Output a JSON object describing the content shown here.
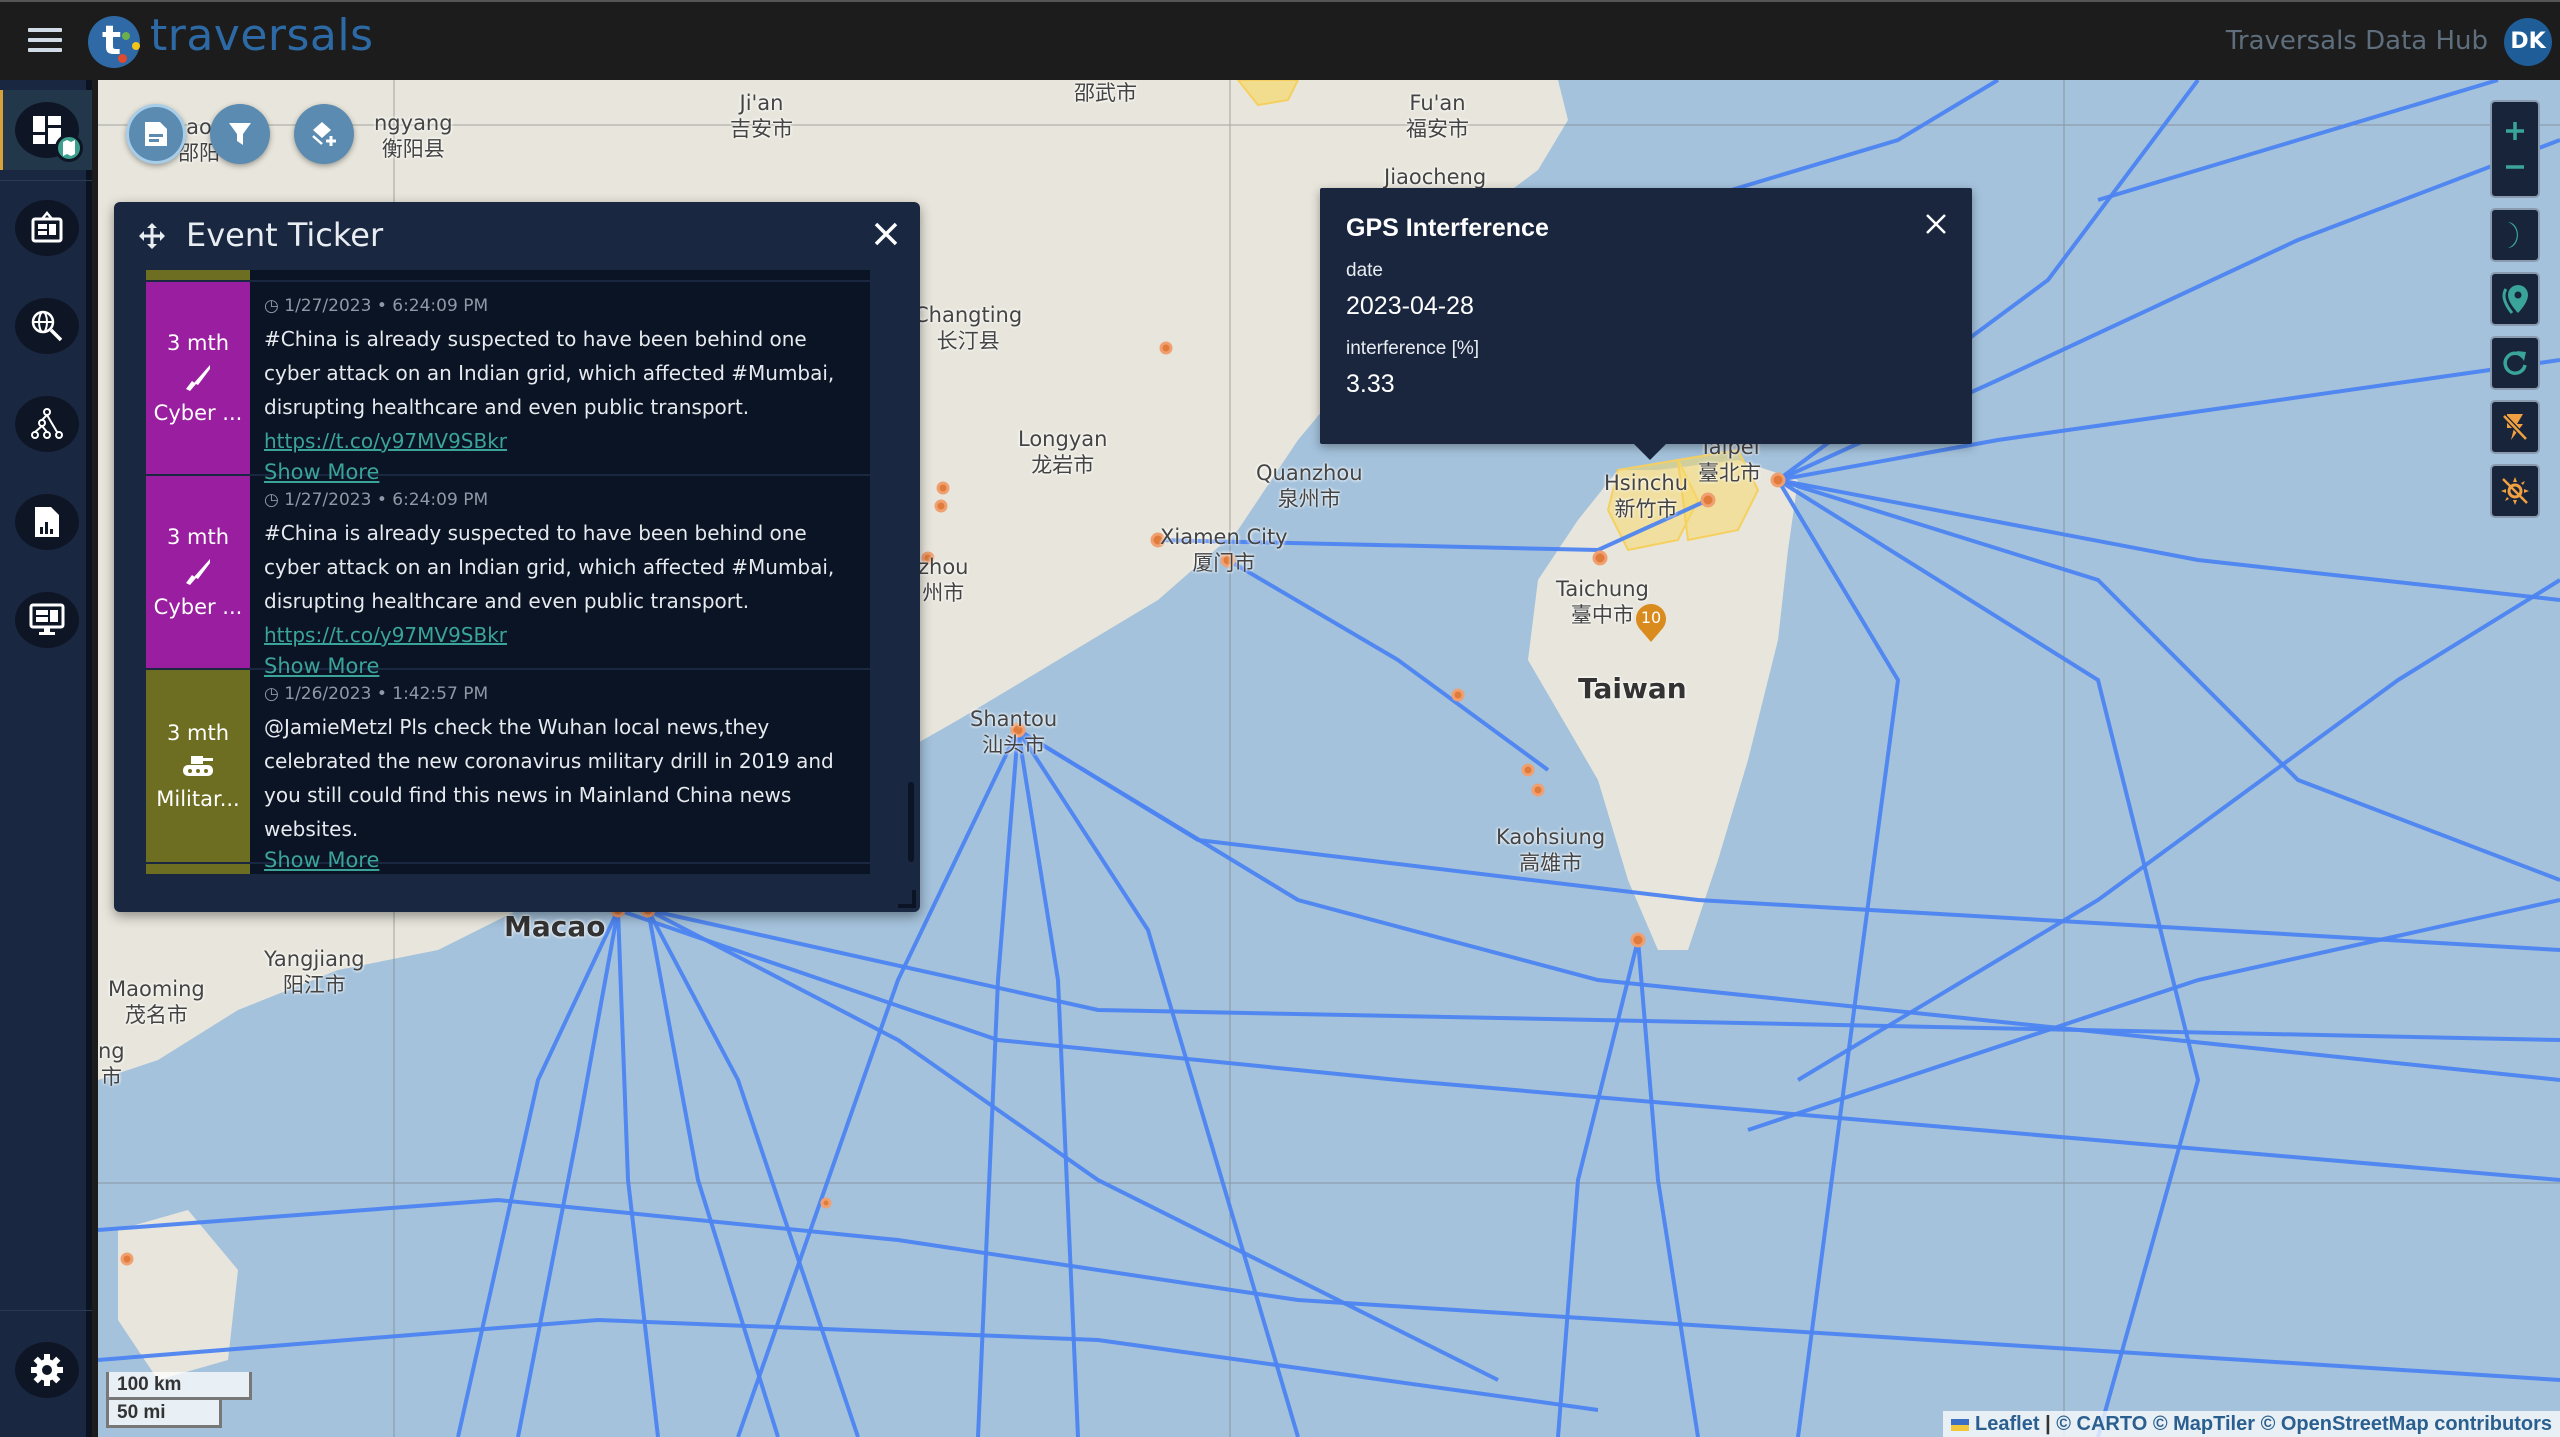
{
  "header": {
    "brand": "traversals",
    "hub_title": "Traversals Data Hub",
    "avatar_initials": "DK"
  },
  "sidebar": {
    "items": [
      {
        "name": "dashboard-map",
        "icon": "dashboard-map-icon",
        "active": true
      },
      {
        "name": "board",
        "icon": "presentation-board-icon"
      },
      {
        "name": "web-search",
        "icon": "globe-search-icon"
      },
      {
        "name": "network",
        "icon": "hierarchy-icon"
      },
      {
        "name": "report",
        "icon": "file-chart-icon"
      },
      {
        "name": "monitor",
        "icon": "monitor-dashboard-icon"
      },
      {
        "name": "settings",
        "icon": "gear-icon"
      }
    ]
  },
  "map_toolbar": {
    "buttons": [
      {
        "name": "notes",
        "icon": "document-icon"
      },
      {
        "name": "filter",
        "icon": "filter-icon"
      },
      {
        "name": "add-layer",
        "icon": "layer-plus-icon"
      }
    ]
  },
  "event_ticker": {
    "title": "Event Ticker",
    "events": [
      {
        "age": "3 mth",
        "category": "Cyber ...",
        "category_icon": "knife-icon",
        "color": "#9a1fa0",
        "timestamp": "1/27/2023 • 6:24:09 PM",
        "text": "#China is already suspected to have been behind one cyber attack on an Indian grid, which affected #Mumbai, disrupting healthcare and even public transport.",
        "link": "https://t.co/y97MV9SBkr",
        "show_more": "Show More"
      },
      {
        "age": "3 mth",
        "category": "Cyber ...",
        "category_icon": "knife-icon",
        "color": "#9a1fa0",
        "timestamp": "1/27/2023 • 6:24:09 PM",
        "text": "#China is already suspected to have been behind one cyber attack on an Indian grid, which affected #Mumbai, disrupting healthcare and even public transport.",
        "link": "https://t.co/y97MV9SBkr",
        "show_more": "Show More"
      },
      {
        "age": "3 mth",
        "category": "Militar...",
        "category_icon": "tank-icon",
        "color": "#6d6e21",
        "timestamp": "1/26/2023 • 1:42:57 PM",
        "text": "@JamieMetzl Pls check the Wuhan local news,they celebrated the new coronavirus military drill in 2019 and you still could find this news in Mainland China news websites.",
        "link": "",
        "show_more": "Show More"
      }
    ],
    "colors": {
      "cyber": "#9a1fa0",
      "military": "#6d6e21"
    }
  },
  "gps_popup": {
    "title": "GPS Interference",
    "fields": [
      {
        "key": "date",
        "value": "2023-04-28"
      },
      {
        "key": "interference [%]",
        "value": "3.33"
      }
    ]
  },
  "map": {
    "labels": [
      {
        "text": "Ji'an\n吉安市"
      },
      {
        "text": "邵武市"
      },
      {
        "text": "Fu'an\n福安市"
      },
      {
        "text": "Jiaocheng"
      },
      {
        "text": "ngyang\n衡阳县"
      },
      {
        "text": "ao\n邵阳"
      },
      {
        "text": "Changting\n长汀县"
      },
      {
        "text": "Longyan\n龙岩市"
      },
      {
        "text": "Quanzhou\n泉州市"
      },
      {
        "text": "Xiamen City\n厦门市"
      },
      {
        "text": "zhou\n州市"
      },
      {
        "text": "Shantou\n汕头市"
      },
      {
        "text": "Hsinchu\n新竹市"
      },
      {
        "text": "Taipei\n臺北市"
      },
      {
        "text": "Taichung\n臺中市"
      },
      {
        "text": "Taiwan"
      },
      {
        "text": "Kaohsiung\n高雄市"
      },
      {
        "text": "Macao"
      },
      {
        "text": "Yangjiang\n阳江市"
      },
      {
        "text": "Maoming\n茂名市"
      },
      {
        "text": "ng\n市"
      }
    ],
    "cluster_marker": "10",
    "colors": {
      "water": "#a4c2dc",
      "land": "#e8e6dc",
      "cable": "#4d84f0",
      "landing": "#e07b3c",
      "gps_zone": "#f5d96b"
    },
    "scale": {
      "metric": "100 km",
      "imperial": "50 mi"
    },
    "attribution": {
      "leaflet": "Leaflet",
      "sources": "© CARTO © MapTiler © OpenStreetMap contributors"
    }
  },
  "map_controls": [
    {
      "name": "zoom-in",
      "icon": "plus-icon"
    },
    {
      "name": "zoom-out",
      "icon": "minus-icon"
    },
    {
      "name": "dark-mode",
      "icon": "moon-icon"
    },
    {
      "name": "locations",
      "icon": "map-pin-icon"
    },
    {
      "name": "refresh",
      "icon": "refresh-icon"
    },
    {
      "name": "disable-events",
      "icon": "flash-off-icon"
    },
    {
      "name": "disable-weather",
      "icon": "sun-off-icon"
    }
  ]
}
